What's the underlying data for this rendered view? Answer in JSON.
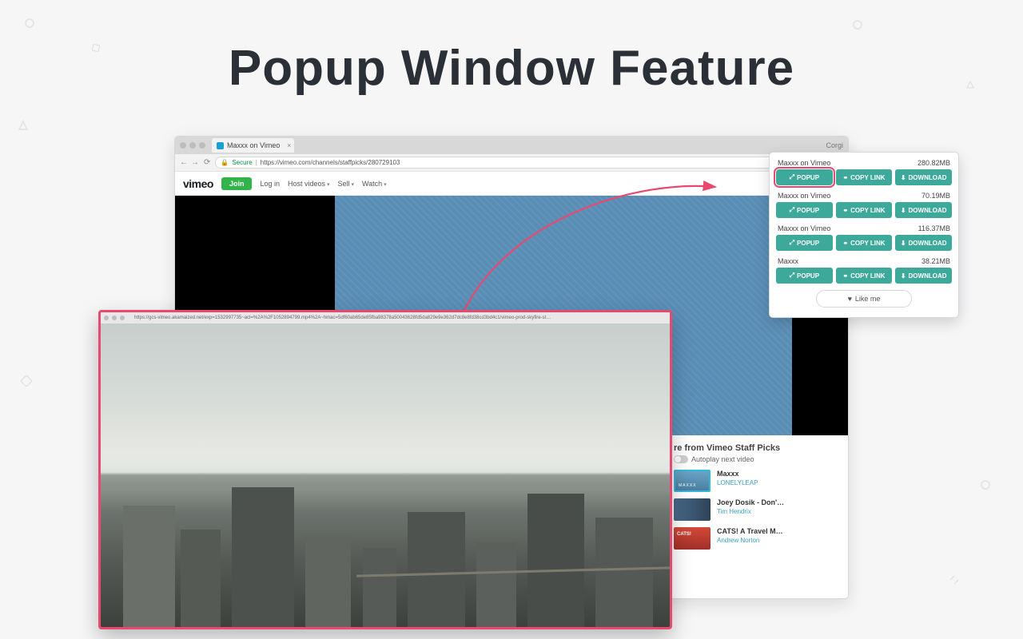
{
  "title": "Popup Window Feature",
  "browser": {
    "tab_title": "Maxxx on Vimeo",
    "profile": "Corgi",
    "secure_label": "Secure",
    "url": "https://vimeo.com/channels/staffpicks/280729103"
  },
  "vimeo_nav": {
    "logo": "vimeo",
    "join": "Join",
    "login": "Log in",
    "host": "Host videos",
    "sell": "Sell",
    "watch": "Watch"
  },
  "sidebar": {
    "more_from": "re from Vimeo Staff Picks",
    "autoplay": "Autoplay next video",
    "recs": [
      {
        "title": "Maxxx",
        "author": "LONELYLEAP"
      },
      {
        "title": "Joey Dosik - Don'…",
        "author": "Tim Hendrix"
      },
      {
        "title": "CATS! A Travel M…",
        "author": "Andrew Norton"
      }
    ]
  },
  "extension": {
    "items": [
      {
        "title": "Maxxx on Vimeo",
        "size": "280.82MB"
      },
      {
        "title": "Maxxx on Vimeo",
        "size": "70.19MB"
      },
      {
        "title": "Maxxx on Vimeo",
        "size": "116.37MB"
      },
      {
        "title": "Maxxx",
        "size": "38.21MB"
      }
    ],
    "btn_popup": "POPUP",
    "btn_copy": "COPY LINK",
    "btn_download": "DOWNLOAD",
    "like": "Like me"
  },
  "popup": {
    "url": "https://gcs-vimeo.akamaized.net/exp=1532997735~acl=%2A%2F1052894799.mp4%2A~hmac=5df60ab65de85fba98378a50043628fd5da829e9e362d7dc8e8fd38cd3bd4c1/vimeo-prod-skyfire-st…"
  }
}
